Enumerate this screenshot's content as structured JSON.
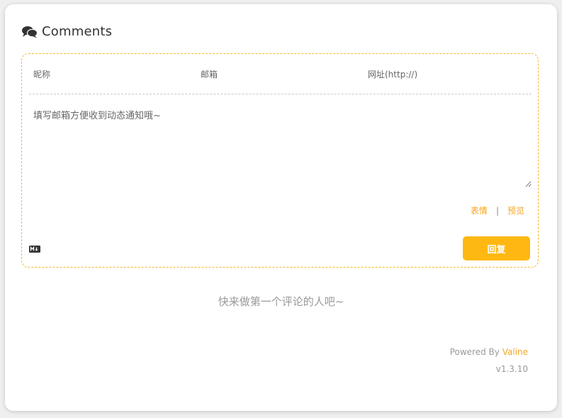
{
  "header": {
    "icon": "comments-icon",
    "title": "Comments"
  },
  "form": {
    "nick_placeholder": "昵称",
    "mail_placeholder": "邮箱",
    "link_placeholder": "网址(http://)",
    "comment_placeholder": "填写邮箱方便收到动态通知哦~",
    "emoji_label": "表情",
    "separator": "|",
    "preview_label": "预览",
    "markdown_icon": "markdown-icon",
    "reply_label": "回复"
  },
  "empty_message": "快来做第一个评论的人吧~",
  "footer": {
    "powered_prefix": "Powered By",
    "brand": "Valine",
    "version": "v1.3.10"
  },
  "colors": {
    "accent": "#f5a623",
    "button": "#ffb812",
    "panel_border": "#f5b92d"
  }
}
